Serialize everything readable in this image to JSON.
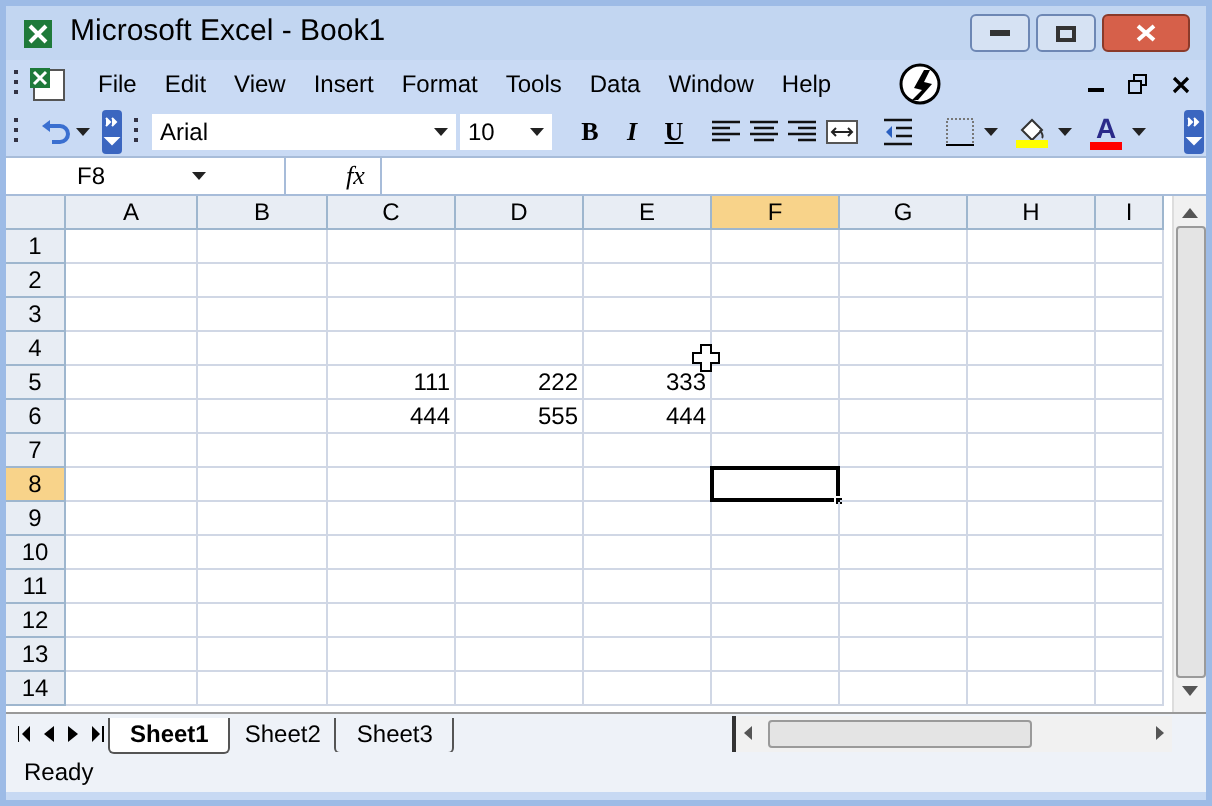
{
  "window": {
    "title": "Microsoft Excel - Book1"
  },
  "menu": [
    {
      "label": "File"
    },
    {
      "label": "Edit"
    },
    {
      "label": "View"
    },
    {
      "label": "Insert"
    },
    {
      "label": "Format"
    },
    {
      "label": "Tools"
    },
    {
      "label": "Data"
    },
    {
      "label": "Window"
    },
    {
      "label": "Help"
    }
  ],
  "toolbar": {
    "font": "Arial",
    "size": "10",
    "format_buttons": [
      {
        "label": "B",
        "kind": "bold"
      },
      {
        "label": "I",
        "kind": "italic"
      },
      {
        "label": "U",
        "kind": "underline"
      }
    ],
    "font_color_label": "A"
  },
  "formula_bar": {
    "name_box": "F8",
    "fx_label": "fx"
  },
  "grid": {
    "columns": [
      {
        "label": "A",
        "selected": false
      },
      {
        "label": "B",
        "selected": false
      },
      {
        "label": "C",
        "selected": false
      },
      {
        "label": "D",
        "selected": false
      },
      {
        "label": "E",
        "selected": false
      },
      {
        "label": "F",
        "selected": true
      },
      {
        "label": "G",
        "selected": false
      },
      {
        "label": "H",
        "selected": false
      },
      {
        "label": "I",
        "selected": false
      }
    ],
    "rows": [
      {
        "label": "1",
        "selected": false
      },
      {
        "label": "2",
        "selected": false
      },
      {
        "label": "3",
        "selected": false
      },
      {
        "label": "4",
        "selected": false
      },
      {
        "label": "5",
        "selected": false,
        "cells": [
          null,
          null,
          "111",
          "222",
          "333"
        ]
      },
      {
        "label": "6",
        "selected": false,
        "cells": [
          null,
          null,
          "444",
          "555",
          "444"
        ]
      },
      {
        "label": "7",
        "selected": false
      },
      {
        "label": "8",
        "selected": true
      },
      {
        "label": "9",
        "selected": false
      },
      {
        "label": "10",
        "selected": false
      },
      {
        "label": "11",
        "selected": false
      },
      {
        "label": "12",
        "selected": false
      },
      {
        "label": "13",
        "selected": false
      },
      {
        "label": "14",
        "selected": false
      }
    ]
  },
  "sheet_tabs": [
    {
      "label": "Sheet1",
      "selected": true
    },
    {
      "label": "Sheet2",
      "selected": false
    },
    {
      "label": "Sheet3",
      "selected": false
    }
  ],
  "status_bar": {
    "text": "Ready"
  }
}
